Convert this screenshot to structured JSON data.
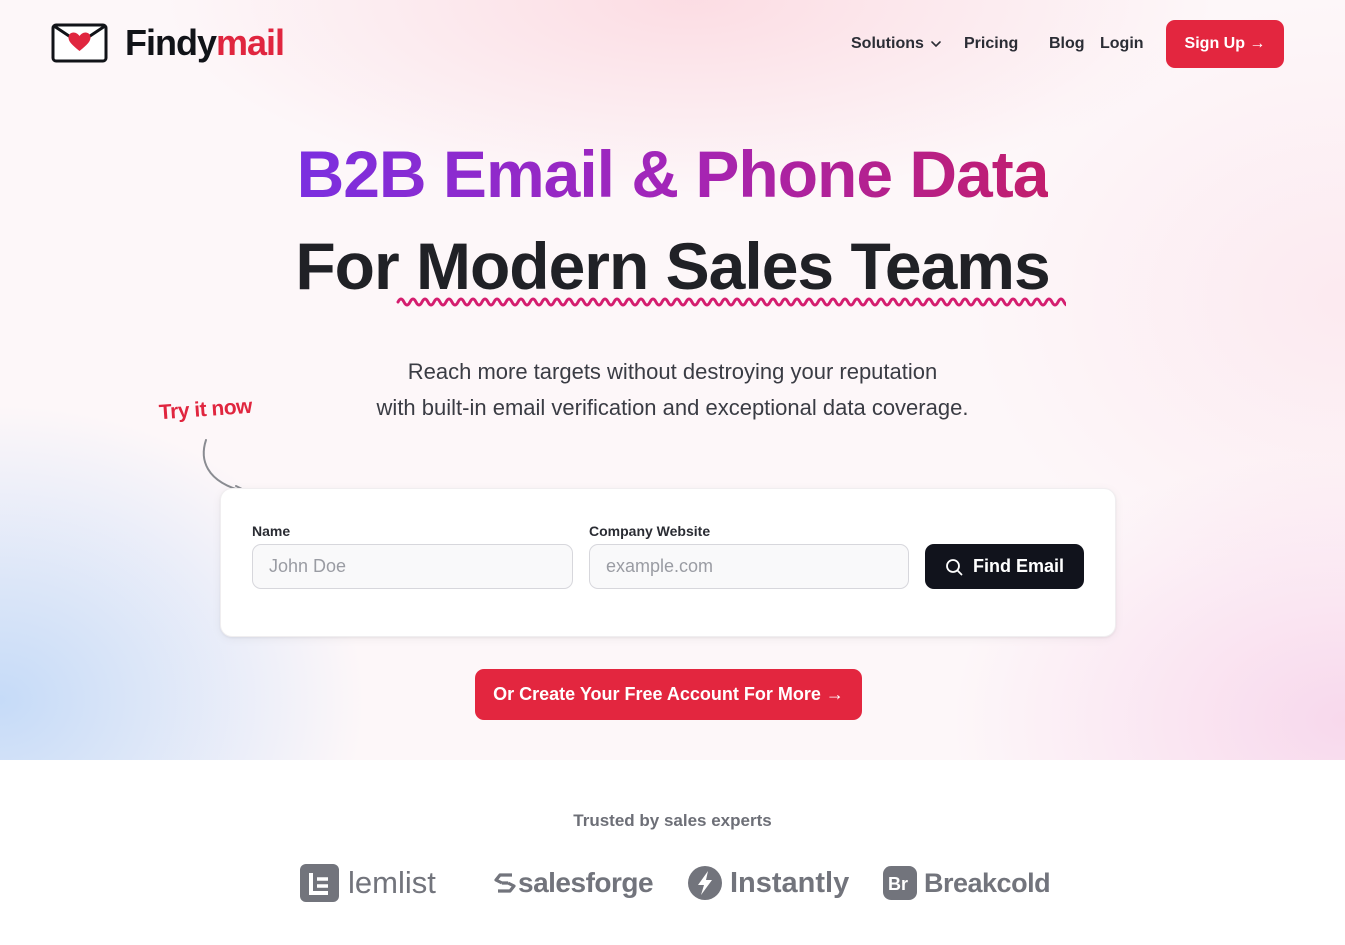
{
  "header": {
    "brand": {
      "name_part1": "Findy",
      "name_part2": "mail",
      "accent": "#e0263f"
    },
    "nav": {
      "solutions": "Solutions",
      "pricing": "Pricing",
      "blog": "Blog",
      "login": "Login"
    },
    "signup_label": "Sign Up →"
  },
  "hero": {
    "headline_colored": "B2B Email & Phone Data",
    "headline_plain_prefix": "For ",
    "headline_plain_underlined": "Modern Sales Teams",
    "subtitle_line1": "Reach more targets without destroying your reputation",
    "subtitle_line2": "with built-in email verification and exceptional data coverage.",
    "try_now": "Try it now"
  },
  "form": {
    "name_label": "Name",
    "name_placeholder": "John Doe",
    "name_value": "",
    "website_label": "Company Website",
    "website_placeholder": "example.com",
    "website_value": "",
    "find_button": "Find Email"
  },
  "cta": {
    "create_account": "Or Create Your Free Account For More →"
  },
  "trusted": {
    "heading": "Trusted by sales experts",
    "logos": [
      {
        "name": "lemlist",
        "icon": "lemlist-logo-icon"
      },
      {
        "name": "salesforge",
        "icon": "salesforge-logo-icon"
      },
      {
        "name": "Instantly",
        "icon": "instantly-bolt-icon"
      },
      {
        "name": "Breakcold",
        "icon": "breakcold-br-icon"
      }
    ]
  },
  "colors": {
    "primary_red": "#e3263f",
    "dark": "#11131c",
    "headline_gradient": [
      "#7b2fe0",
      "#a325b8",
      "#c21d6c"
    ]
  }
}
